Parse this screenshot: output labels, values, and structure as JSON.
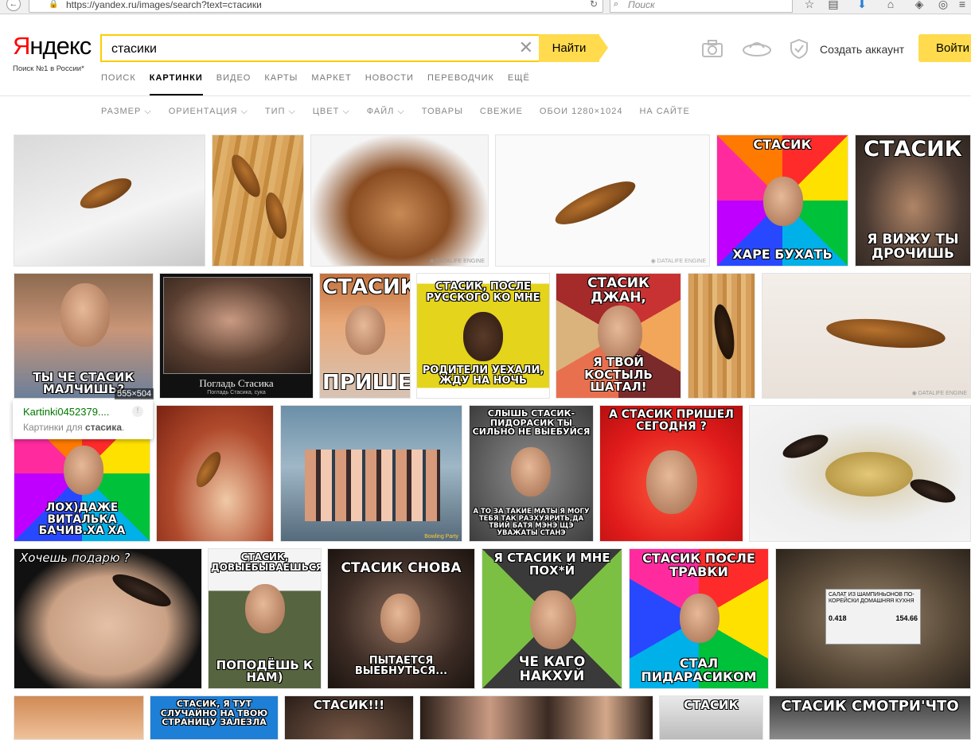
{
  "browser": {
    "url": "https://yandex.ru/images/search?text=стасики",
    "search_placeholder": "Поиск"
  },
  "header": {
    "logo_first": "Я",
    "logo_rest": "ндекс",
    "logo_sub": "Поиск №1 в России*",
    "query": "стасики",
    "search_button": "Найти",
    "create_account": "Создать аккаунт",
    "login": "Войти"
  },
  "tabs": [
    "ПОИСК",
    "КАРТИНКИ",
    "ВИДЕО",
    "КАРТЫ",
    "МАРКЕТ",
    "НОВОСТИ",
    "ПЕРЕВОДЧИК",
    "ЕЩЁ"
  ],
  "active_tab": "КАРТИНКИ",
  "filters": [
    "РАЗМЕР ⌵",
    "ОРИЕНТАЦИЯ ⌵",
    "ТИП ⌵",
    "ЦВЕТ ⌵",
    "ФАЙЛ ⌵",
    "ТОВАРЫ",
    "СВЕЖИЕ",
    "ОБОИ 1280×1024",
    "НА САЙТЕ"
  ],
  "tooltip": {
    "title": "Kartinki0452379....",
    "sub_prefix": "Картинки для ",
    "sub_bold": "стасика",
    "sub_suffix": ".",
    "size": "555×504"
  },
  "captions": {
    "r1_meme1_top": "СТАСИК",
    "r1_meme1_bot": "ХАРЕ БУХАТЬ",
    "r1_meme2_top": "СТАСИК",
    "r1_meme2_bot": "Я ВИЖУ ТЫ ДРОЧИШЬ",
    "r2_t1": "ТЫ ЧЕ СТАСИК МАЛЧИШЬ?",
    "r2_poster_title": "Погладь Стасика",
    "r2_poster_sub": "Погладь Стасика, сука",
    "r2_t3_top": "СТАСИК",
    "r2_t3_bot": "ПРИШЕЛ",
    "r2_t4_top": "СТАСИК, ПОСЛЕ РУССКОГО КО МНЕ",
    "r2_t4_bot": "РОДИТЕЛИ УЕХАЛИ, ЖДУ НА НОЧЬ",
    "r2_t5_top": "СТАСИК ДЖАН,",
    "r2_t5_bot": "Я ТВОЙ КОСТЫЛЬ ШАТАЛ!",
    "r3_t1_bot": "ЛОХ)ДАЖЕ ВИТАЛЬКА БАЧИВ.ХА ХА",
    "r3_t4_top": "СЛЫШЬ СТАСИК-ПИДОРАСИК ТЫ СИЛЬНО НЕ ВЫЕБУЙСЯ",
    "r3_t4_bot": "А ТО ЗА ТАКИЕ МАТЫ Я МОГУ ТЕБЯ ТАК РАЗХУЯРИТЬ,ДА ТВИЙ БАТЯ МЭНЭ ЩЭ УВАЖАТЫ СТАНЭ",
    "r3_t5_top": "А СТАСИК ПРИШЕЛ СЕГОДНЯ ?",
    "r4_t1_top": "Хочешь подарю ?",
    "r4_t2_top": "СТАСИК, ДОВЫЁБЫВАЕШЬСЯ,",
    "r4_t2_bot": "ПОПОДЁШЬ К НАМ)",
    "r4_t3_top": "СТАСИК СНОВА",
    "r4_t3_bot": "ПЫТАЕТСЯ ВЫЕБНУТЬСЯ...",
    "r4_t4_top": "Я СТАСИК И МНЕ ПОХ*Й",
    "r4_t4_bot": "ЧЕ КАГО НАКХУЙ",
    "r4_t5_top": "СТАСИК ПОСЛЕ ТРАВКИ",
    "r4_t5_bot": "СТАЛ ПИДАРАСИКОМ",
    "r4_label": "САЛАТ ИЗ ШАМПИНЬОНОВ ПО-КОРЕЙСКИ ДОМАШНЯЯ КУХНЯ",
    "r4_price1": "0.418",
    "r4_price2": "154.66",
    "r5_t2_top": "СТАСИК, Я ТУТ СЛУЧАЙНО НА ТВОЮ СТРАНИЦУ ЗАЛЕЗЛА",
    "r5_t3_top": "СТАСИК!!!",
    "r5_t5_top": "СТАСИК",
    "r5_t6_top": "СТАСИК СМОТРИ'ЧТО"
  },
  "colors": {
    "accent": "#ffdb4d",
    "logo_red": "#ff0000",
    "tooltip_green": "#007700"
  }
}
